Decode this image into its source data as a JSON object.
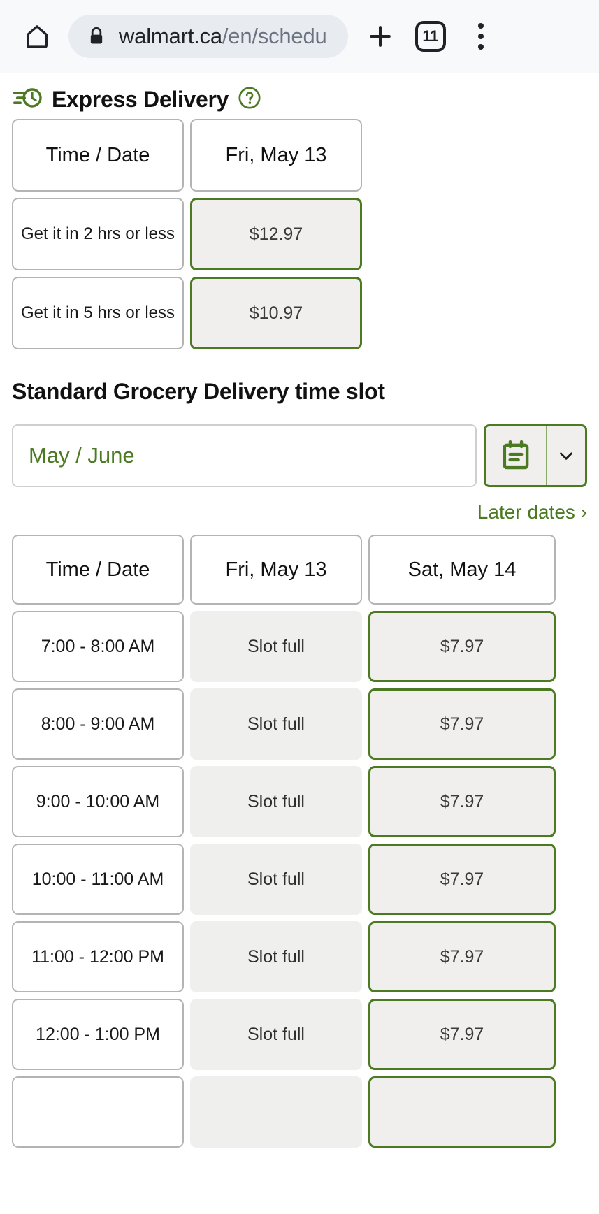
{
  "browser": {
    "home_icon": "home-icon",
    "lock_icon": "lock-icon",
    "url_domain": "walmart.ca",
    "url_path": "/en/schedu",
    "new_tab_icon": "plus-icon",
    "tab_count": "11",
    "menu_icon": "three-dot-menu-icon"
  },
  "colors": {
    "brand_green": "#4b7a22",
    "cell_gray": "#efefed",
    "border_gray": "#b4b4b4"
  },
  "express": {
    "icon": "express-delivery-clock-icon",
    "title": "Express Delivery",
    "help_icon": "help-question-icon",
    "headers": [
      "Time / Date",
      "Fri, May 13"
    ],
    "rows": [
      {
        "label": "Get it in 2 hrs or less",
        "value": "$12.97",
        "state": "price"
      },
      {
        "label": "Get it in 5 hrs or less",
        "value": "$10.97",
        "state": "price"
      }
    ]
  },
  "standard": {
    "title": "Standard Grocery Delivery time slot",
    "month_value": "May / June",
    "calendar_icon": "calendar-icon",
    "chevron_icon": "chevron-down-icon",
    "later_dates_label": "Later dates ›",
    "headers": [
      "Time / Date",
      "Fri, May 13",
      "Sat, May 14"
    ],
    "rows": [
      {
        "time": "7:00 - 8:00 AM",
        "fri": "Slot full",
        "sat": "$7.97"
      },
      {
        "time": "8:00 - 9:00 AM",
        "fri": "Slot full",
        "sat": "$7.97"
      },
      {
        "time": "9:00 - 10:00 AM",
        "fri": "Slot full",
        "sat": "$7.97"
      },
      {
        "time": "10:00 - 11:00 AM",
        "fri": "Slot full",
        "sat": "$7.97"
      },
      {
        "time": "11:00 - 12:00 PM",
        "fri": "Slot full",
        "sat": "$7.97"
      },
      {
        "time": "12:00 - 1:00 PM",
        "fri": "Slot full",
        "sat": "$7.97"
      },
      {
        "time": "",
        "fri": "",
        "sat": ""
      }
    ]
  }
}
